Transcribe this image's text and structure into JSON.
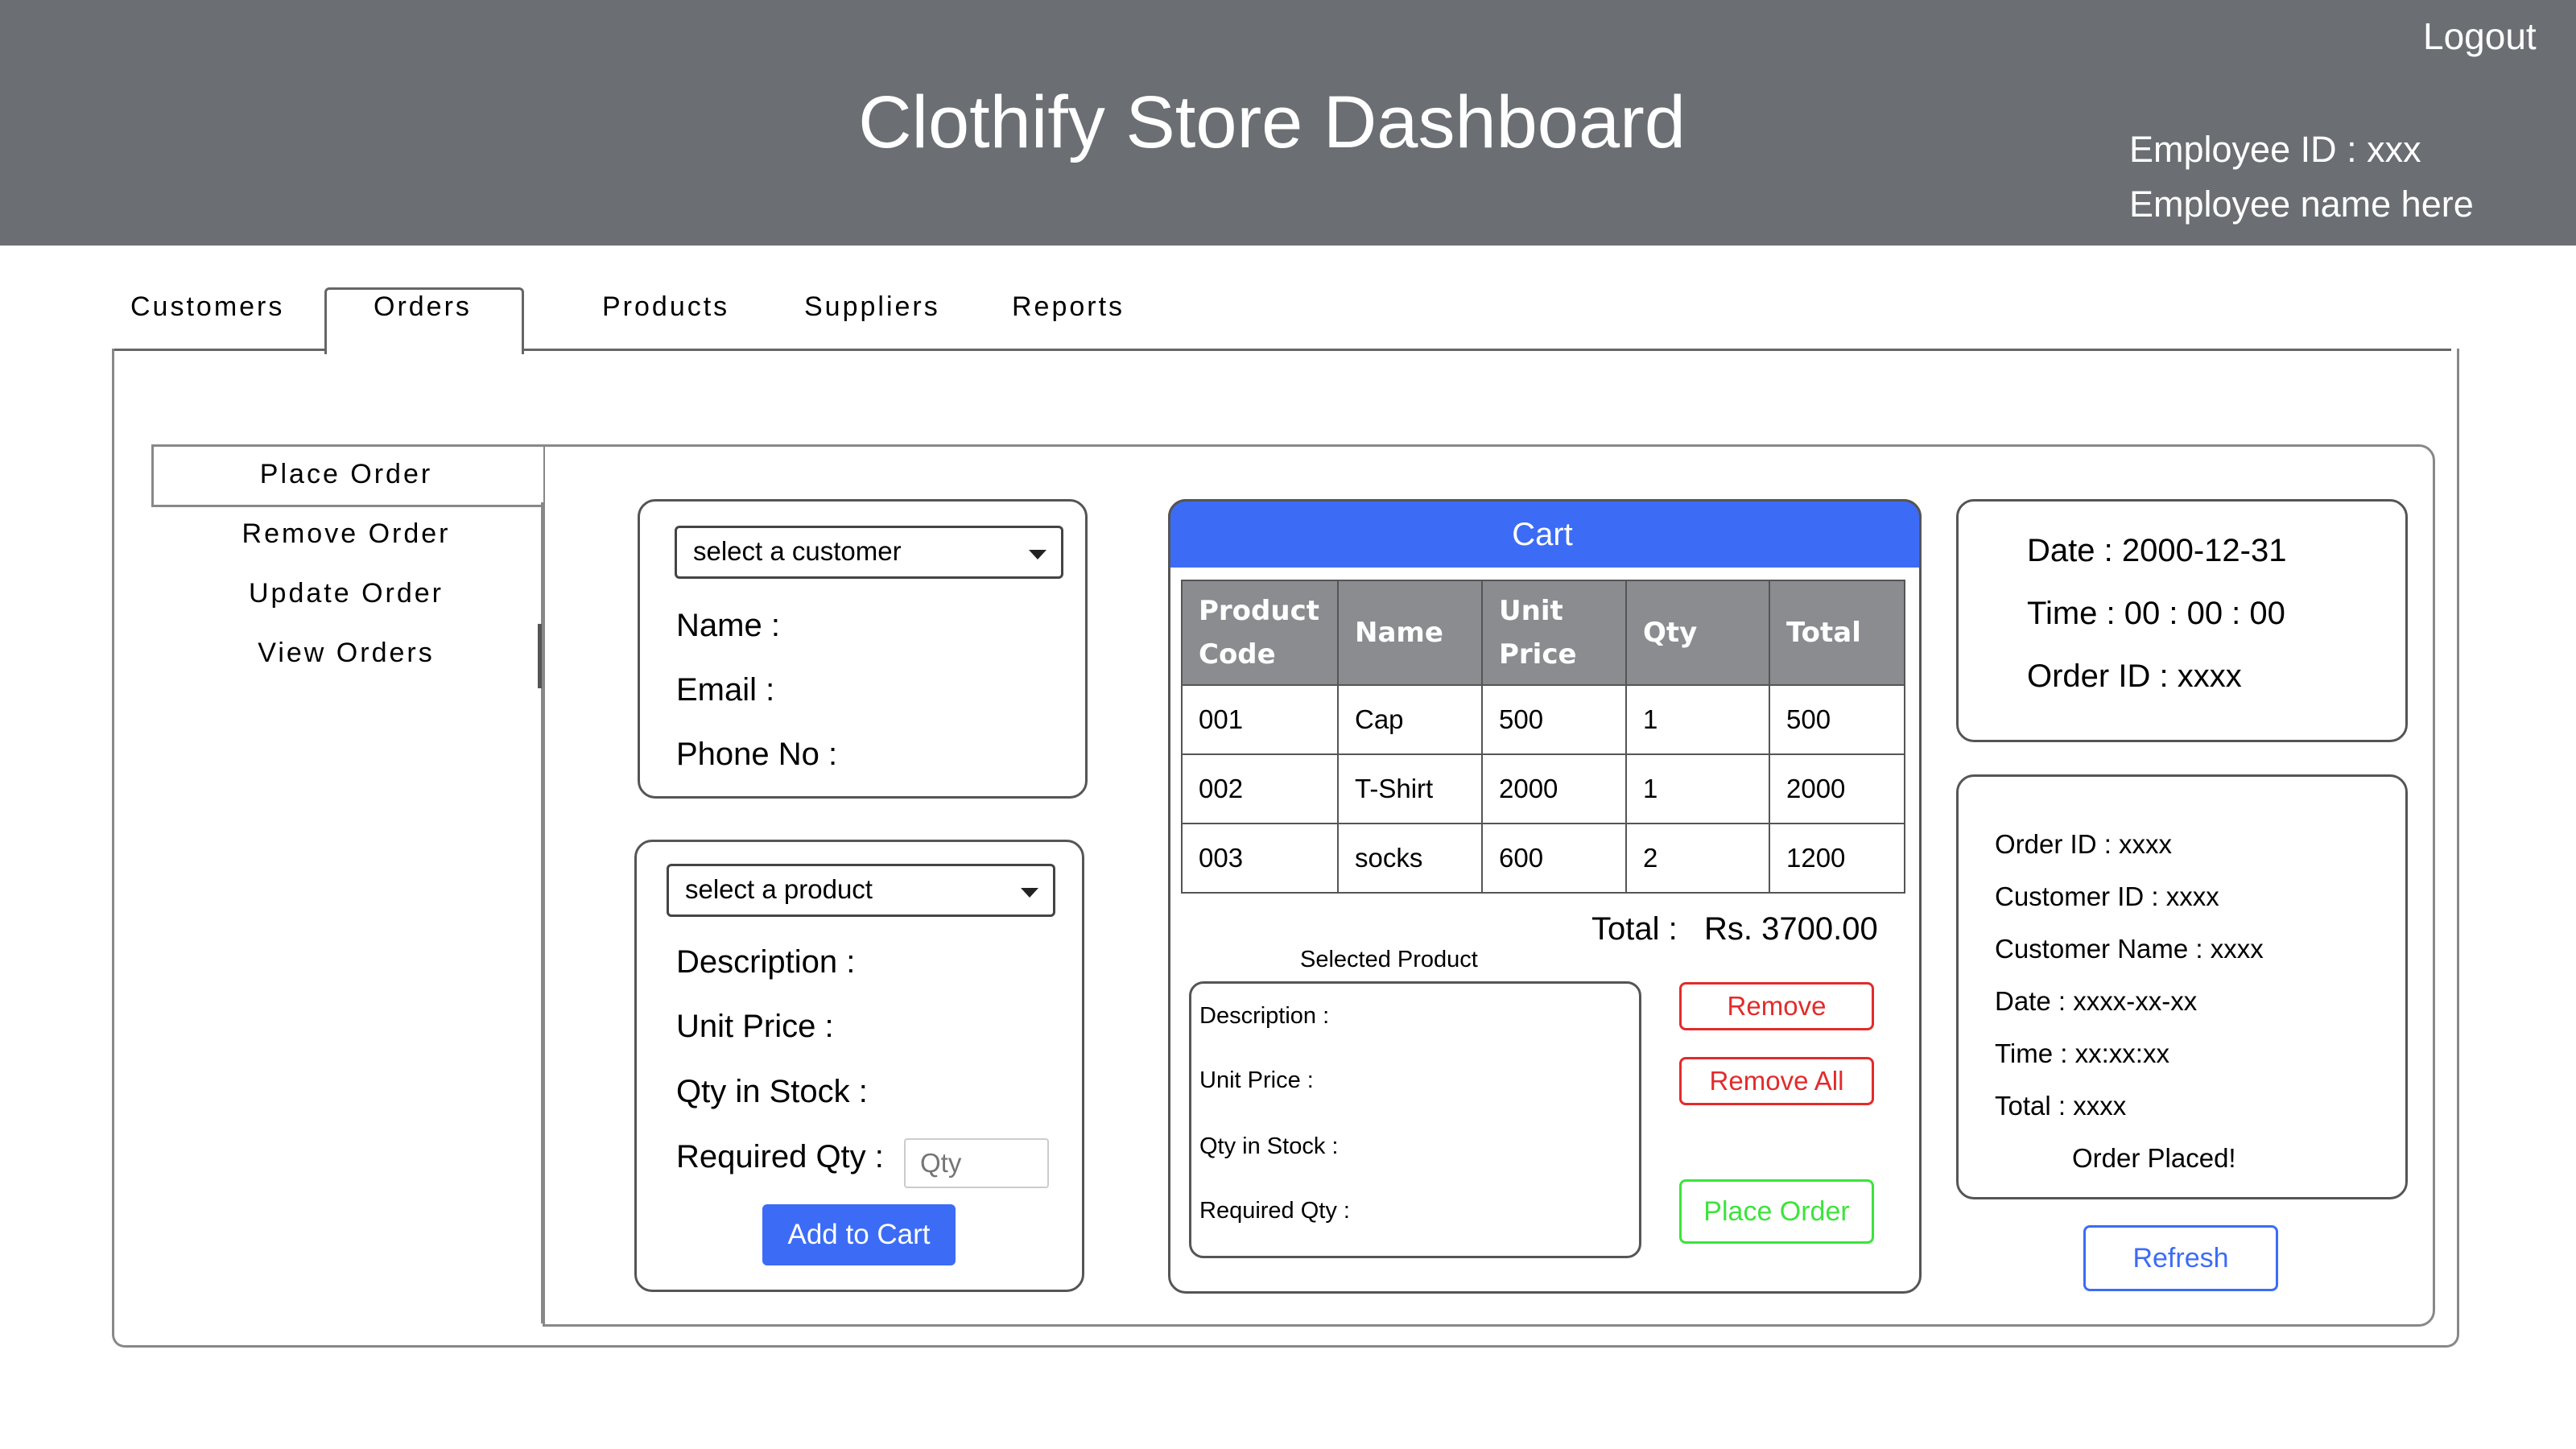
{
  "header": {
    "title": "Clothify Store Dashboard",
    "logout": "Logout",
    "employee_id": "Employee ID : xxx",
    "employee_name": "Employee name here"
  },
  "tabs": [
    {
      "label": "Customers"
    },
    {
      "label": "Orders"
    },
    {
      "label": "Products"
    },
    {
      "label": "Suppliers"
    },
    {
      "label": "Reports"
    }
  ],
  "active_tab": "Orders",
  "sidebar": {
    "items": [
      {
        "label": "Place Order"
      },
      {
        "label": "Remove Order"
      },
      {
        "label": "Update Order"
      },
      {
        "label": "View Orders"
      }
    ]
  },
  "customer_card": {
    "select_placeholder": "select a customer",
    "name_label": "Name :",
    "email_label": "Email :",
    "phone_label": "Phone No :"
  },
  "product_card": {
    "select_placeholder": "select a product",
    "description_label": "Description :",
    "unit_price_label": "Unit Price :",
    "qty_in_stock_label": "Qty in Stock :",
    "required_qty_label": "Required Qty :",
    "qty_placeholder": "Qty",
    "add_to_cart": "Add to Cart"
  },
  "cart": {
    "title": "Cart",
    "columns": [
      "Product Code",
      "Name",
      "Unit Price",
      "Qty",
      "Total"
    ],
    "column_lines": [
      [
        "Product",
        "Code"
      ],
      [
        "Name"
      ],
      [
        "Unit",
        "Price"
      ],
      [
        "Qty"
      ],
      [
        "Total"
      ]
    ],
    "rows": [
      [
        "001",
        "Cap",
        "500",
        "1",
        "500"
      ],
      [
        "002",
        "T-Shirt",
        "2000",
        "1",
        "2000"
      ],
      [
        "003",
        "socks",
        "600",
        "2",
        "1200"
      ]
    ],
    "total_label": "Total :",
    "total_value": "Rs. 3700.00",
    "selected_product_title": "Selected Product",
    "selected": {
      "description": "Description :",
      "unit_price": "Unit Price :",
      "qty_in_stock": "Qty in Stock :",
      "required_qty": "Required Qty :"
    },
    "remove": "Remove",
    "remove_all": "Remove All",
    "place_order": "Place Order"
  },
  "order_info": {
    "date": "Date :  2000-12-31",
    "time": "Time :  00 : 00 : 00",
    "order_id": "Order ID : xxxx"
  },
  "summary": {
    "order_id": "Order ID : xxxx",
    "customer_id": "Customer ID : xxxx",
    "customer_name": "Customer Name : xxxx",
    "date": "Date : xxxx-xx-xx",
    "time": "Time : xx:xx:xx",
    "total": "Total : xxxx",
    "status": "Order Placed!"
  },
  "refresh": "Refresh",
  "colors": {
    "header_bg": "#6b6e72",
    "cart_header": "#3c6cf6",
    "table_header": "#8a8c90",
    "primary_button": "#3c6cf6",
    "remove_red": "#e32b2b",
    "place_order_green": "#3ce43c",
    "refresh_blue": "#3c6cf6"
  }
}
